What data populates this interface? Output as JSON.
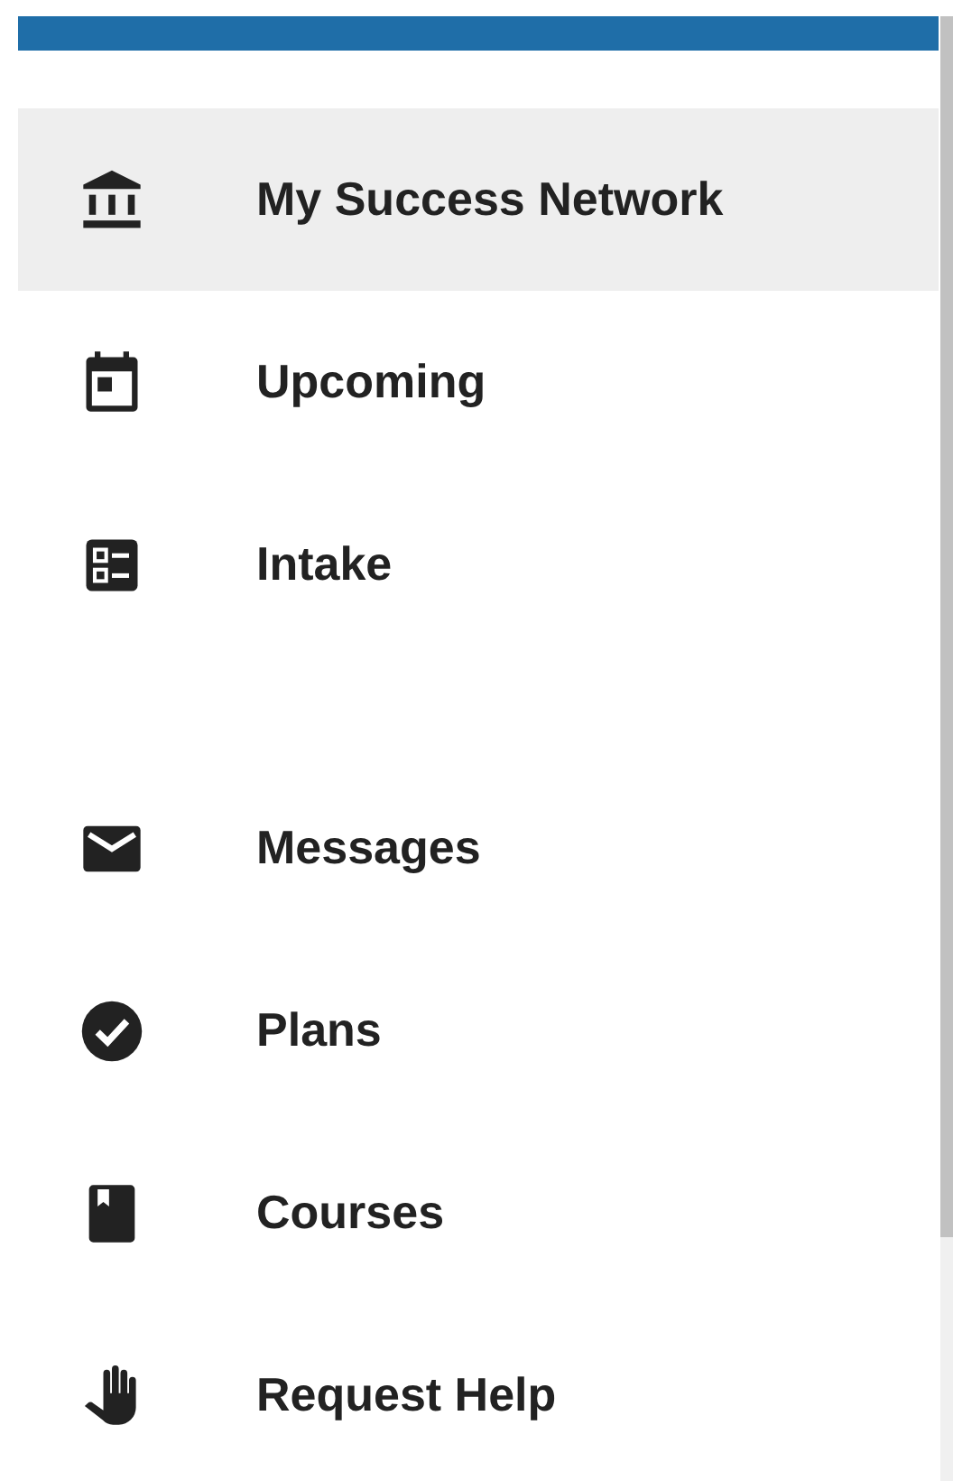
{
  "groups": [
    {
      "items": [
        {
          "label": "My Success Network",
          "kind": "institution",
          "selected": true
        },
        {
          "label": "Upcoming",
          "kind": "calendar",
          "selected": false
        },
        {
          "label": "Intake",
          "kind": "checklist",
          "selected": false
        }
      ]
    },
    {
      "items": [
        {
          "label": "Messages",
          "kind": "mail",
          "selected": false
        },
        {
          "label": "Plans",
          "kind": "done",
          "selected": false
        },
        {
          "label": "Courses",
          "kind": "book",
          "selected": false
        },
        {
          "label": "Request Help",
          "kind": "hand",
          "selected": false
        }
      ]
    }
  ]
}
